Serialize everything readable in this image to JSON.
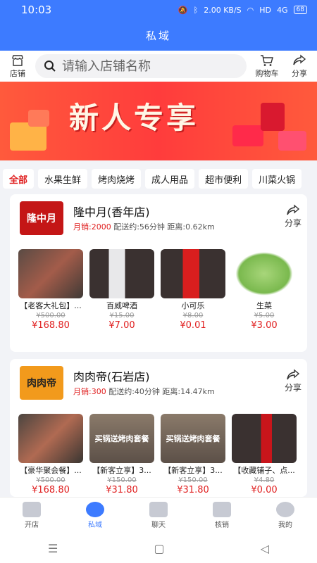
{
  "status": {
    "time": "10:03",
    "speed": "2.00 KB/S",
    "hd": "HD",
    "net": "4G",
    "battery": "68"
  },
  "title": "私域",
  "toolbar": {
    "store_label": "店铺",
    "cart_label": "购物车",
    "share_label": "分享",
    "search_placeholder": "请输入店铺名称"
  },
  "banner": {
    "text": "新人专享"
  },
  "categories": [
    "全部",
    "水果生鲜",
    "烤肉烧烤",
    "成人用品",
    "超市便利",
    "川菜火锅"
  ],
  "shops": [
    {
      "logo_text": "隆中月",
      "name": "隆中月(香年店)",
      "sales_label": "月销:2000",
      "delivery": "配送约:56分钟",
      "distance": "距离:0.62km",
      "share_label": "分享",
      "products": [
        {
          "name": "【老客大礼包】...",
          "old": "¥500.00",
          "price": "¥168.80"
        },
        {
          "name": "百威啤酒",
          "old": "¥15.00",
          "price": "¥7.00"
        },
        {
          "name": "小可乐",
          "old": "¥8.00",
          "price": "¥0.01"
        },
        {
          "name": "生菜",
          "old": "¥5.00",
          "price": "¥3.00"
        }
      ]
    },
    {
      "logo_text": "肉肉帝",
      "name": "肉肉帝(石岩店)",
      "sales_label": "月销:300",
      "delivery": "配送约:40分钟",
      "distance": "距离:14.47km",
      "share_label": "分享",
      "products": [
        {
          "name": "【豪华聚会餐】...",
          "old": "¥500.00",
          "price": "¥168.80"
        },
        {
          "name": "【新客立享】3...",
          "old": "¥150.00",
          "price": "¥31.80",
          "overlay": "买锅送烤肉套餐"
        },
        {
          "name": "【新客立享】3...",
          "old": "¥150.00",
          "price": "¥31.80",
          "overlay": "买锅送烤肉套餐"
        },
        {
          "name": "【收藏铺子、点...",
          "old": "¥4.80",
          "price": "¥0.00"
        }
      ]
    }
  ],
  "nav": [
    "开店",
    "私域",
    "聊天",
    "核销",
    "我的"
  ],
  "colors": {
    "accent": "#3d7bff",
    "price": "#e02020",
    "banner": "#ff4a3c"
  }
}
